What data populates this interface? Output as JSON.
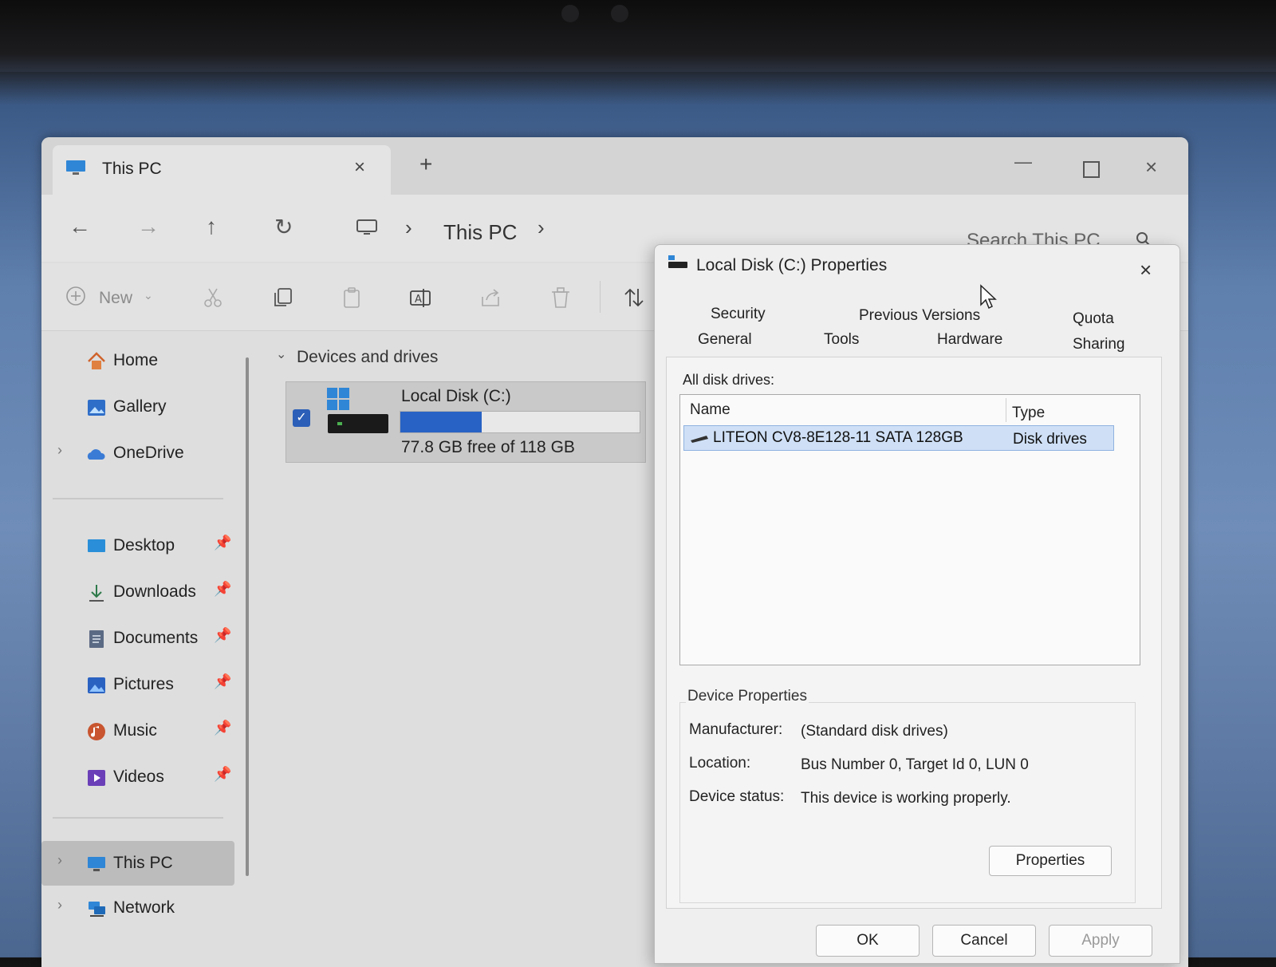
{
  "explorer": {
    "tab_title": "This PC",
    "tab_close": "×",
    "new_tab": "+",
    "window_buttons": {
      "minimize": "—",
      "close": "×"
    },
    "nav": {
      "back": "←",
      "forward": "→",
      "up": "↑",
      "refresh": "↻"
    },
    "breadcrumb": {
      "sep": "›",
      "current": "This PC"
    },
    "search_placeholder": "Search This PC",
    "commands": {
      "new_label": "New",
      "new_chevron": "⌄",
      "icons": [
        "cut-icon",
        "copy-icon",
        "paste-icon",
        "rename-icon",
        "share-icon",
        "delete-icon",
        "sort-icon"
      ]
    },
    "sidebar": {
      "items": [
        {
          "label": "Home",
          "icon": "home-icon",
          "pinned": false
        },
        {
          "label": "Gallery",
          "icon": "gallery-icon",
          "pinned": false
        },
        {
          "label": "OneDrive",
          "icon": "onedrive-icon",
          "pinned": false
        },
        {
          "label": "Desktop",
          "icon": "desktop-icon",
          "pinned": true
        },
        {
          "label": "Downloads",
          "icon": "downloads-icon",
          "pinned": true
        },
        {
          "label": "Documents",
          "icon": "documents-icon",
          "pinned": true
        },
        {
          "label": "Pictures",
          "icon": "pictures-icon",
          "pinned": true
        },
        {
          "label": "Music",
          "icon": "music-icon",
          "pinned": true
        },
        {
          "label": "Videos",
          "icon": "videos-icon",
          "pinned": true
        },
        {
          "label": "This PC",
          "icon": "pc-icon",
          "pinned": false,
          "selected": true
        },
        {
          "label": "Network",
          "icon": "network-icon",
          "pinned": false
        }
      ],
      "pin_glyph": "📌",
      "expand_glyph": "›"
    },
    "section": {
      "chevron": "⌄",
      "title": "Devices and drives"
    },
    "drive": {
      "name": "Local Disk (C:)",
      "free_text": "77.8 GB free of 118 GB",
      "used_fraction": 0.34,
      "checked": true,
      "check_glyph": "✓"
    }
  },
  "dialog": {
    "title": "Local Disk (C:) Properties",
    "close": "×",
    "tabs": {
      "security": "Security",
      "previous_versions": "Previous Versions",
      "quota": "Quota",
      "general": "General",
      "tools": "Tools",
      "hardware": "Hardware",
      "sharing": "Sharing"
    },
    "active_tab": "Hardware",
    "all_disks_label": "All disk drives:",
    "columns": {
      "name": "Name",
      "type": "Type"
    },
    "disks": [
      {
        "name": "LITEON CV8-8E128-11 SATA 128GB",
        "type": "Disk drives"
      }
    ],
    "device_properties": {
      "legend": "Device Properties",
      "manufacturer_label": "Manufacturer:",
      "manufacturer_value": "(Standard disk drives)",
      "location_label": "Location:",
      "location_value": "Bus Number 0, Target Id 0, LUN 0",
      "status_label": "Device status:",
      "status_value": "This device is working properly.",
      "properties_button": "Properties"
    },
    "footer": {
      "ok": "OK",
      "cancel": "Cancel",
      "apply": "Apply"
    }
  },
  "colors": {
    "accent": "#2862c4",
    "selection": "#cfe0f6"
  }
}
